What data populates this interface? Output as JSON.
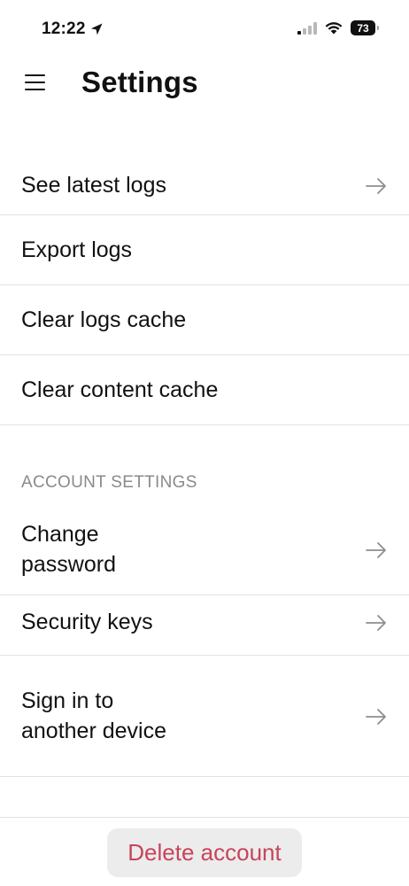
{
  "status_bar": {
    "time": "12:22",
    "battery": "73",
    "icons": [
      "location-arrow-icon",
      "cellular-signal-icon",
      "wifi-icon",
      "battery-icon"
    ]
  },
  "header": {
    "title": "Settings",
    "menu_icon": "hamburger-menu-icon"
  },
  "general_items": [
    {
      "label": "See latest logs",
      "has_arrow": true
    },
    {
      "label": "Export logs",
      "has_arrow": false
    },
    {
      "label": "Clear logs cache",
      "has_arrow": false
    },
    {
      "label": "Clear content cache",
      "has_arrow": false
    }
  ],
  "account_section": {
    "header": "ACCOUNT SETTINGS",
    "items": [
      {
        "label_lines": [
          "Change",
          "password"
        ],
        "has_arrow": true
      },
      {
        "label": "Security keys",
        "has_arrow": true
      },
      {
        "label_lines": [
          "Sign in to",
          "another device"
        ],
        "has_arrow": true
      }
    ]
  },
  "footer": {
    "delete_label": "Delete account"
  },
  "colors": {
    "text": "#111111",
    "section_header": "#8a8a8a",
    "divider": "#e3e3e3",
    "arrow": "#8e8e8e",
    "danger": "#c8445b",
    "button_bg": "#ececec"
  }
}
